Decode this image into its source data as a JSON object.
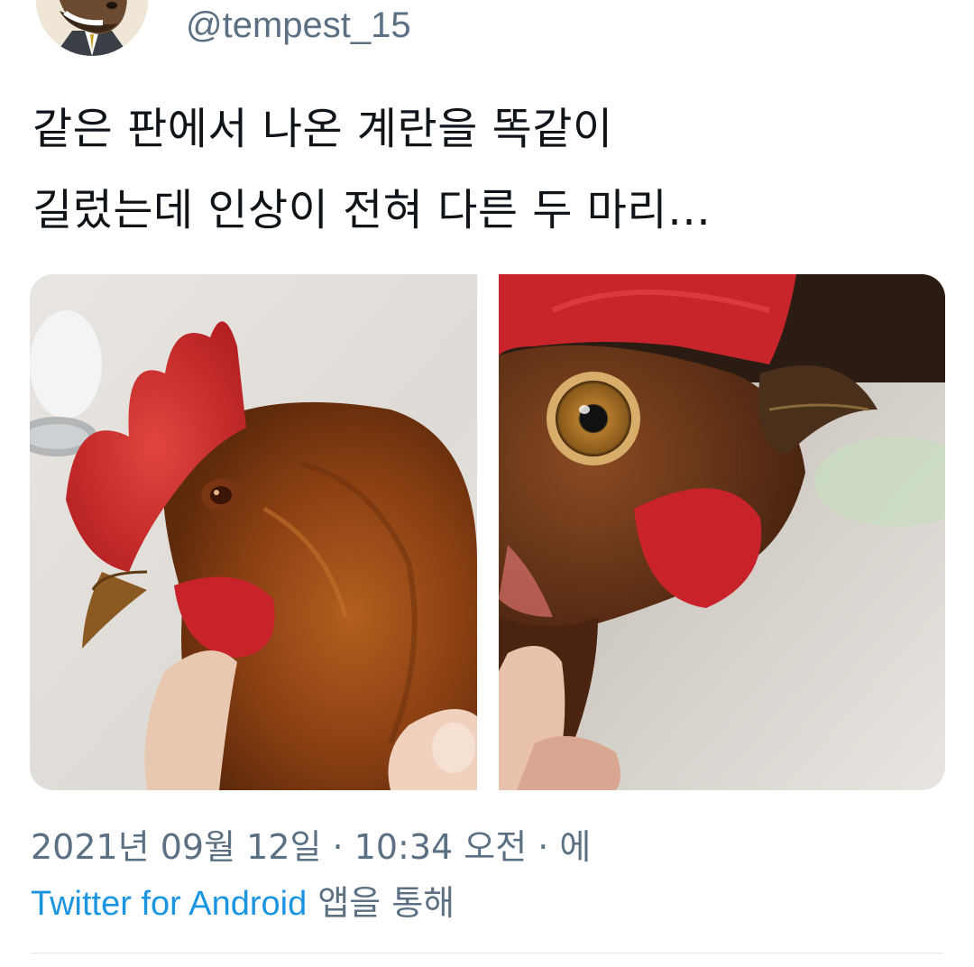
{
  "user": {
    "handle": "@tempest_15",
    "avatar_icon": "horse-mask-avatar-icon"
  },
  "tweet": {
    "text_lines": [
      "같은 판에서 나온 계란을 똑같이",
      "길렀는데 인상이 전혀 다른 두 마리…"
    ],
    "media": [
      {
        "icon": "rooster-photo-left"
      },
      {
        "icon": "rooster-photo-right"
      }
    ]
  },
  "meta": {
    "timestamp": "2021년 09월 12일 · 10:34 오전 · 에",
    "source_link": "Twitter for Android",
    "source_suffix": " 앱을 통해"
  },
  "colors": {
    "handle_gray": "#5b7083",
    "link_blue": "#1b95e0",
    "text": "#0f1419",
    "divider": "#e1e8ed"
  }
}
